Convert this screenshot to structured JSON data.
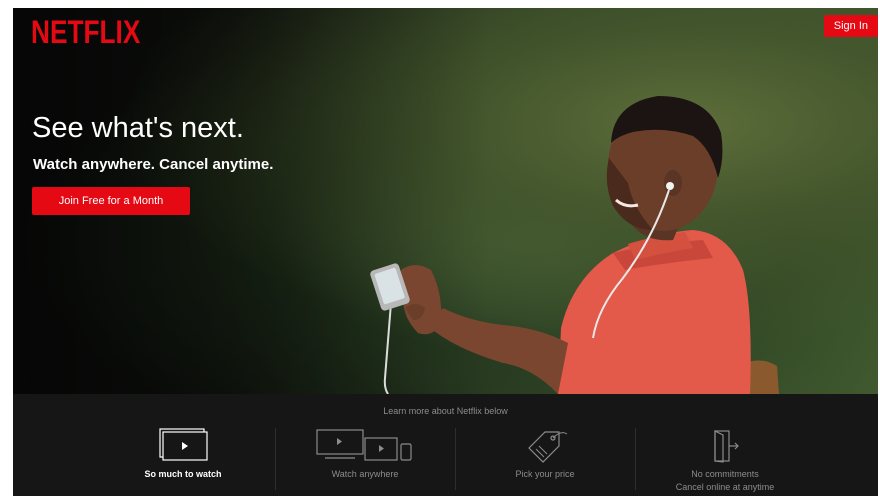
{
  "header": {
    "logo_text": "NETFLIX",
    "signin_label": "Sign In"
  },
  "hero": {
    "headline": "See what's next.",
    "subheadline": "Watch anywhere. Cancel anytime.",
    "cta_label": "Join Free for a Month"
  },
  "features": {
    "intro": "Learn more about Netflix below",
    "items": [
      {
        "icon": "tv-play-icon",
        "label": "So much to watch",
        "active": true
      },
      {
        "icon": "devices-icon",
        "label": "Watch anywhere",
        "active": false
      },
      {
        "icon": "price-tag-icon",
        "label": "Pick your price",
        "active": false
      },
      {
        "icon": "door-exit-icon",
        "label_line1": "No commitments",
        "label_line2": "Cancel online at anytime",
        "active": false
      }
    ]
  },
  "colors": {
    "brand_red": "#e50914",
    "background": "#141414"
  }
}
